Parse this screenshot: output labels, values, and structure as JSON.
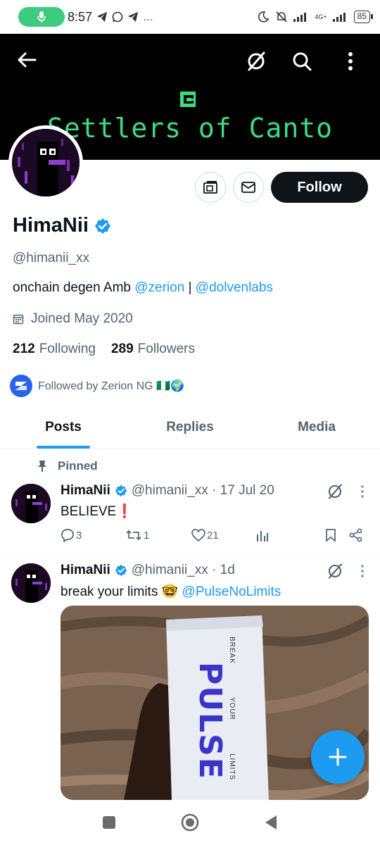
{
  "status_bar": {
    "time": "8:57",
    "extra_icons": "…",
    "network": "4G+",
    "battery": "85"
  },
  "banner": {
    "title": "Settlers of Canto",
    "colors": {
      "background": "#000000",
      "text": "#3ddc84"
    }
  },
  "profile": {
    "name": "HimaNii",
    "handle": "@himanii_xx",
    "bio_prefix": "onchain degen Amb ",
    "bio_link1": "@zerion",
    "bio_sep": " | ",
    "bio_link2": "@dolvenlabs",
    "joined": "Joined May 2020",
    "following_count": "212",
    "following_label": "Following",
    "followers_count": "289",
    "followers_label": "Followers",
    "followed_by": "Followed by Zerion NG 🇳🇬🌍",
    "follow_button": "Follow"
  },
  "tabs": [
    {
      "label": "Posts",
      "active": true
    },
    {
      "label": "Replies",
      "active": false
    },
    {
      "label": "Media",
      "active": false
    }
  ],
  "posts": [
    {
      "pinned_label": "Pinned",
      "name": "HimaNii",
      "meta": "@himanii_xx · 17 Jul 20",
      "text": "BELIEVE",
      "text_emoji": "❗",
      "replies": "3",
      "reposts": "1",
      "likes": "21"
    },
    {
      "name": "HimaNii",
      "meta": "@himanii_xx · 1d",
      "text": "break your limits 🤓 ",
      "mention": "@PulseNoLimits",
      "media": {
        "box_brand": "PULSE",
        "box_words": [
          "BREAK",
          "YOUR",
          "LIMITS"
        ]
      }
    }
  ],
  "colors": {
    "accent": "#1d9bf0",
    "text": "#0f1419",
    "muted": "#536471",
    "follow_bg": "#0f1419"
  }
}
